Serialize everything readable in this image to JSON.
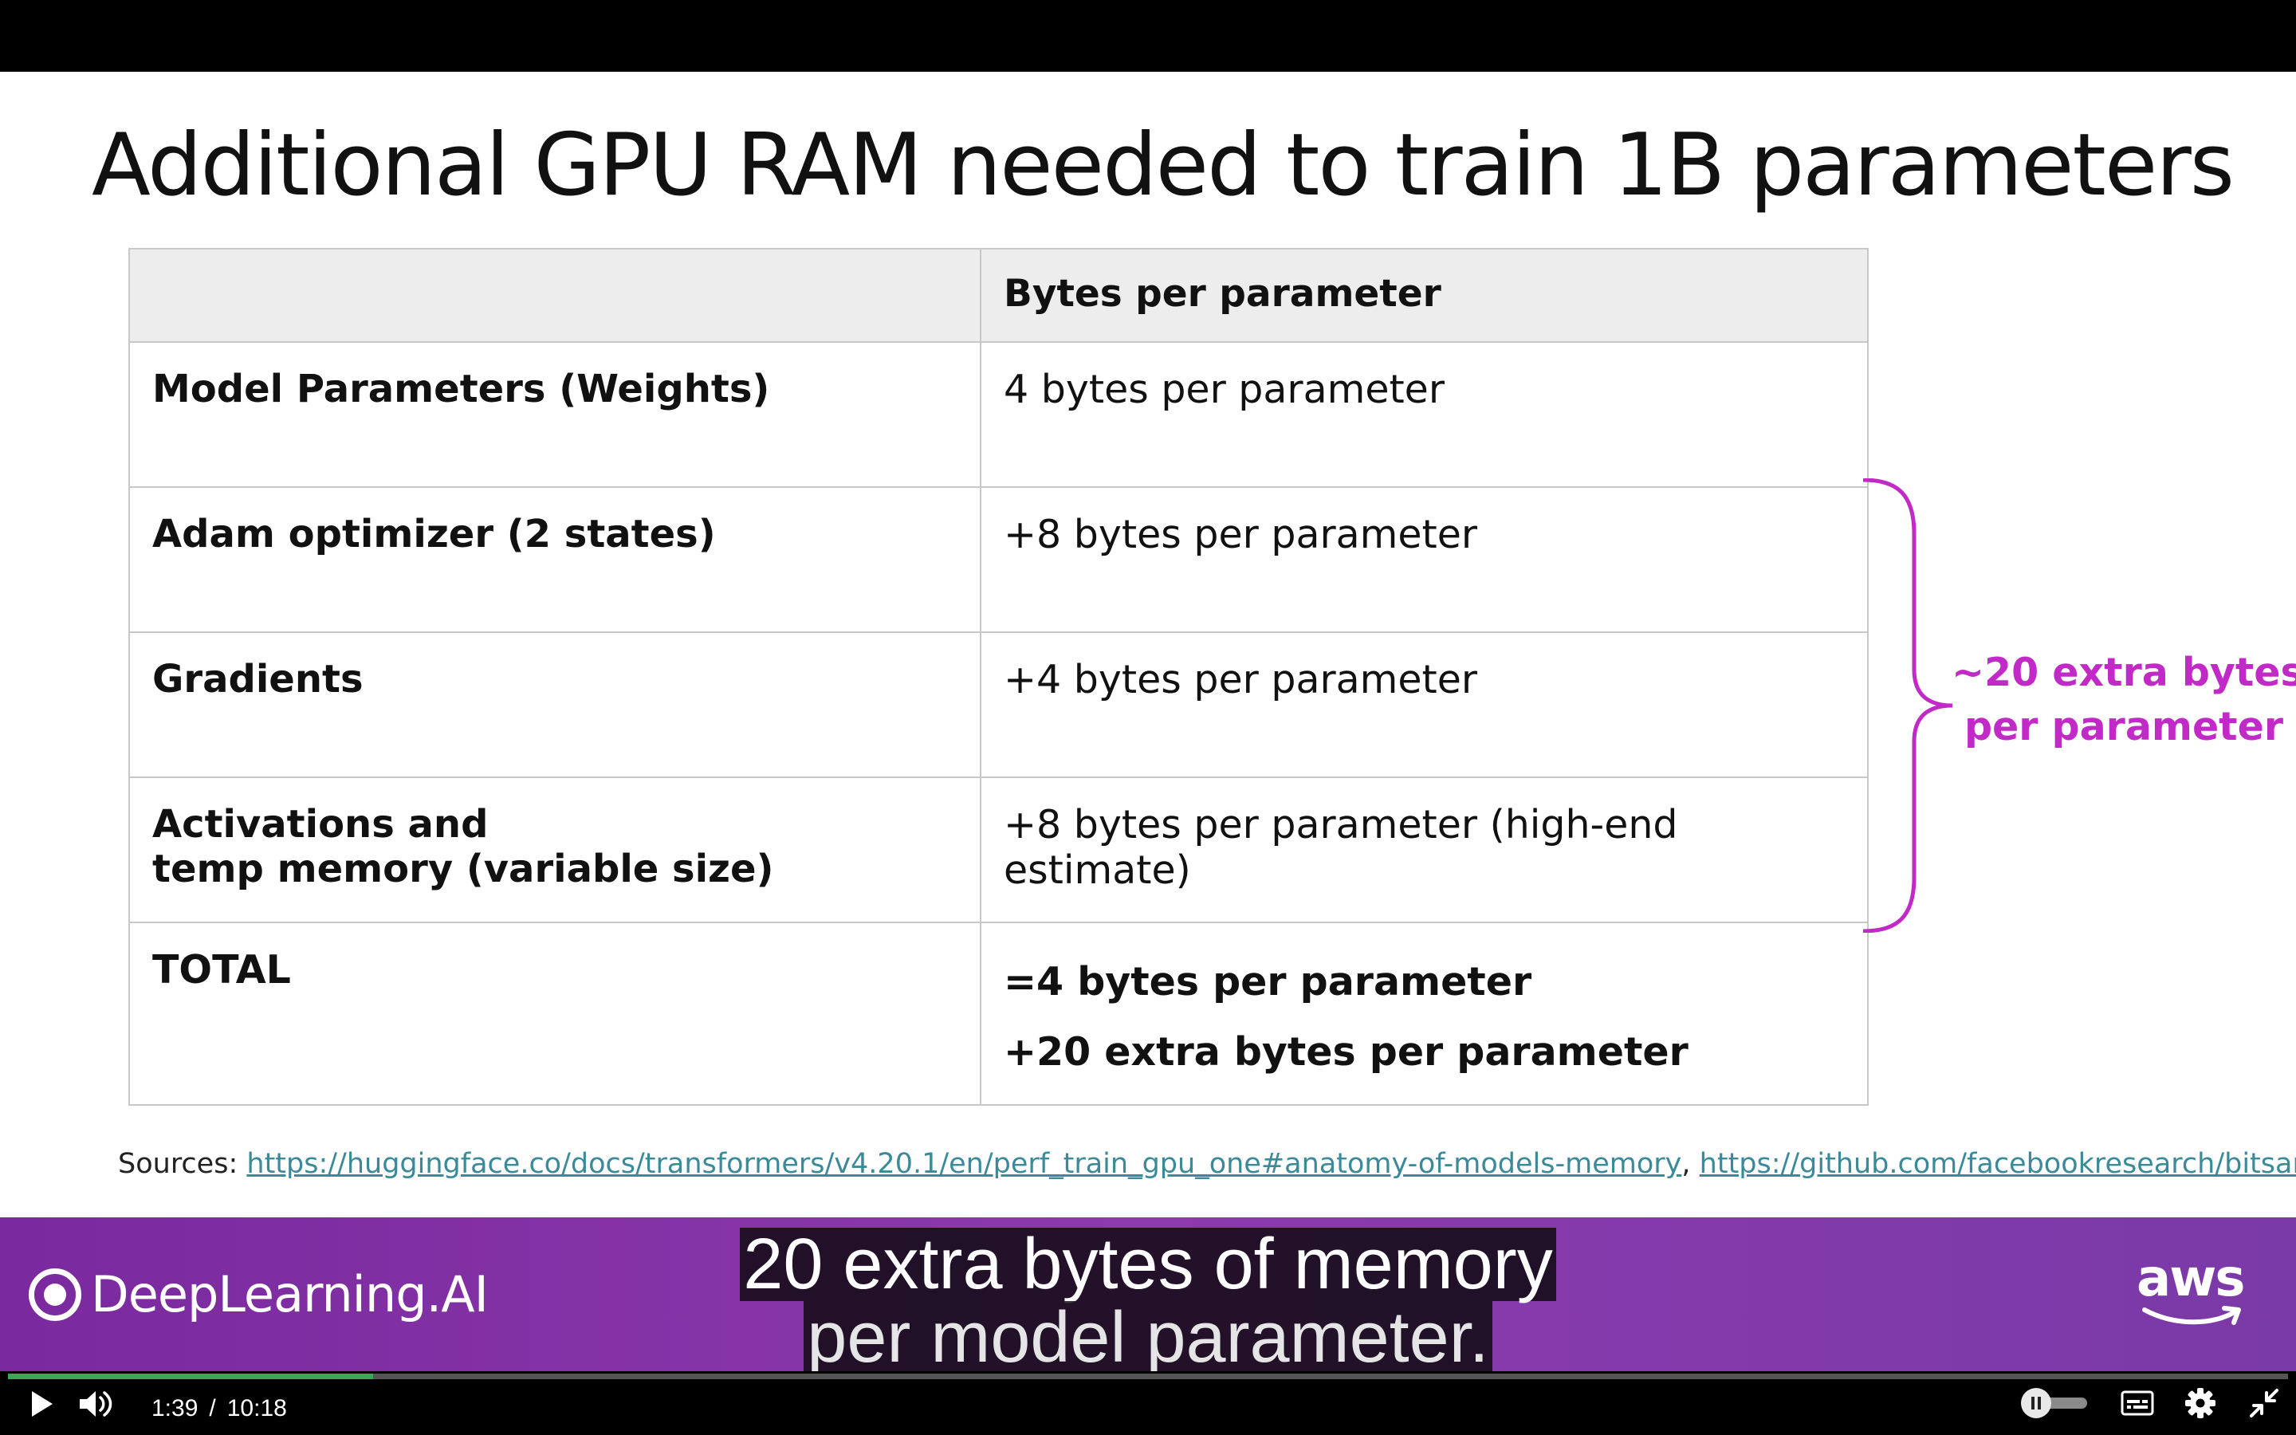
{
  "slide": {
    "title": "Additional GPU RAM needed to train 1B parameters",
    "table": {
      "header": [
        "",
        "Bytes per parameter"
      ],
      "rows": [
        {
          "label": [
            "Model Parameters (Weights)"
          ],
          "value": "4 bytes per parameter"
        },
        {
          "label": [
            "Adam optimizer (2 states)"
          ],
          "value": "+8 bytes per parameter"
        },
        {
          "label": [
            "Gradients"
          ],
          "value": "+4 bytes per parameter"
        },
        {
          "label": [
            "Activations and",
            "temp memory (variable size)"
          ],
          "value": "+8 bytes per parameter (high-end estimate)"
        }
      ],
      "total": {
        "label": "TOTAL",
        "lines": [
          "=4 bytes per parameter",
          "+20 extra bytes per parameter"
        ]
      }
    },
    "brace_label": [
      "~20 extra bytes",
      "per parameter"
    ],
    "sources": {
      "label": "Sources:",
      "links": [
        "https://huggingface.co/docs/transformers/v4.20.1/en/perf_train_gpu_one#anatomy-of-models-memory",
        "https://github.com/facebookresearch/bitsandbytes"
      ],
      "separator": ","
    }
  },
  "banner": {
    "brand": "DeepLearning.AI",
    "partner": "aws"
  },
  "caption": {
    "lines": [
      "20 extra bytes of memory",
      "per model parameter."
    ]
  },
  "player": {
    "current_time": "1:39",
    "separator": "/",
    "duration": "10:18",
    "progress": 0.16,
    "buffered": 0.16,
    "colors": {
      "progress": "#3aa757",
      "accent": "#c22ac8"
    },
    "icons": [
      "play-icon",
      "volume-icon",
      "autoplay-toggle-icon",
      "captions-icon",
      "settings-icon",
      "exit-fullscreen-icon"
    ]
  }
}
